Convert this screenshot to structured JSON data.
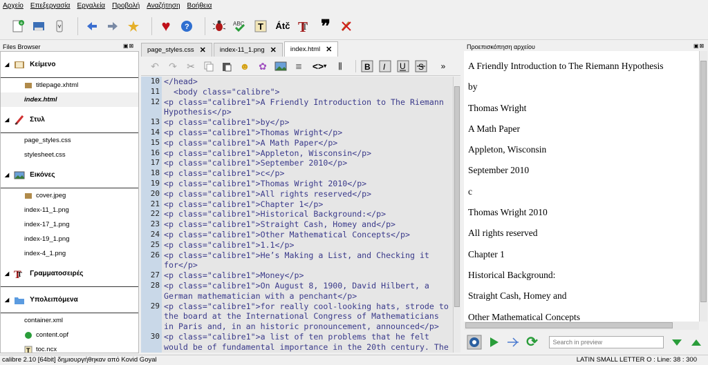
{
  "menu": [
    "Αρχείο",
    "Επεξεργασία",
    "Εργαλεία",
    "Προβολή",
    "Αναζήτηση",
    "Βοήθεια"
  ],
  "panels": {
    "files_title": "Files Browser",
    "preview_title": "Προεπισκόπηση αρχείου"
  },
  "files": {
    "sections": [
      {
        "label": "Κείμενο",
        "items": [
          "titlepage.xhtml",
          "index.html"
        ]
      },
      {
        "label": "Στυλ",
        "items": [
          "page_styles.css",
          "stylesheet.css"
        ]
      },
      {
        "label": "Εικόνες",
        "items": [
          "cover.jpeg",
          "index-11_1.png",
          "index-17_1.png",
          "index-19_1.png",
          "index-4_1.png"
        ]
      },
      {
        "label": "Γραμματοσειρές",
        "items": []
      },
      {
        "label": "Υπολειπόμενα",
        "items": [
          "container.xml",
          "content.opf",
          "toc.ncx"
        ]
      }
    ],
    "selected": "index.html"
  },
  "tabs": [
    "page_styles.css",
    "index-11_1.png",
    "index.html"
  ],
  "active_tab": "index.html",
  "code_lines": [
    {
      "n": "10",
      "t": "</head>"
    },
    {
      "n": "11",
      "t": "  <body class=\"calibre\">"
    },
    {
      "n": "12",
      "t": "<p class=\"calibre1\">A Friendly Introduction to The Riemann Hypothesis</p>"
    },
    {
      "n": "13",
      "t": "<p class=\"calibre1\">by</p>"
    },
    {
      "n": "14",
      "t": "<p class=\"calibre1\">Thomas Wright</p>"
    },
    {
      "n": "15",
      "t": "<p class=\"calibre1\">A Math Paper</p>"
    },
    {
      "n": "16",
      "t": "<p class=\"calibre1\">Appleton, Wisconsin</p>"
    },
    {
      "n": "17",
      "t": "<p class=\"calibre1\">September 2010</p>"
    },
    {
      "n": "18",
      "t": "<p class=\"calibre1\">c</p>"
    },
    {
      "n": "19",
      "t": "<p class=\"calibre1\">Thomas Wright 2010</p>"
    },
    {
      "n": "20",
      "t": "<p class=\"calibre1\">All rights reserved</p>"
    },
    {
      "n": "21",
      "t": "<p class=\"calibre1\">Chapter 1</p>"
    },
    {
      "n": "22",
      "t": "<p class=\"calibre1\">Historical Background:</p>"
    },
    {
      "n": "23",
      "t": "<p class=\"calibre1\">Straight Cash, Homey and</p>"
    },
    {
      "n": "24",
      "t": "<p class=\"calibre1\">Other Mathematical Concepts</p>"
    },
    {
      "n": "25",
      "t": "<p class=\"calibre1\">1.1</p>"
    },
    {
      "n": "26",
      "t": "<p class=\"calibre1\">He’s Making a List, and Checking it for</p>"
    },
    {
      "n": "27",
      "t": "<p class=\"calibre1\">Money</p>"
    },
    {
      "n": "28",
      "t": "<p class=\"calibre1\">On August 8, 1900, David Hilbert, a German mathematician with a penchant</p>"
    },
    {
      "n": "29",
      "t": "<p class=\"calibre1\">for really cool-looking hats, strode to the board at the International Congress of Mathematicians in Paris and, in an historic pronouncement, announced</p>"
    },
    {
      "n": "30",
      "t": "<p class=\"calibre1\">a list of ten problems that he felt would be of fundamental importance in the 20th century. The"
    }
  ],
  "preview": [
    "A Friendly Introduction to The Riemann Hypothesis",
    "by",
    "Thomas Wright",
    "A Math Paper",
    "Appleton, Wisconsin",
    "September 2010",
    "c",
    "Thomas Wright 2010",
    "All rights reserved",
    "Chapter 1",
    "Historical Background:",
    "Straight Cash, Homey and",
    "Other Mathematical Concepts"
  ],
  "search": {
    "placeholder": "Search in preview"
  },
  "status": {
    "left": "calibre 2.10 [64bit] δημιουργήθηκαν από Kovid Goyal",
    "right": "LATIN SMALL LETTER O : Line: 38 : 300"
  },
  "icons": {
    "toolbar": [
      "new-book-icon",
      "save-icon",
      "checkpoint-icon",
      "back-icon",
      "forward-icon",
      "create-checkpoint-icon",
      "donate-heart-icon",
      "help-icon",
      "check-book-icon",
      "spell-check-icon",
      "text-icon",
      "transliterate-icon",
      "fonts-icon",
      "smart-quotes-icon",
      "remove-unused-css-icon"
    ]
  },
  "colors": {
    "gutter": "#c9d8e8",
    "tag": "#8b1a8b",
    "attr": "#3a3a8a"
  }
}
